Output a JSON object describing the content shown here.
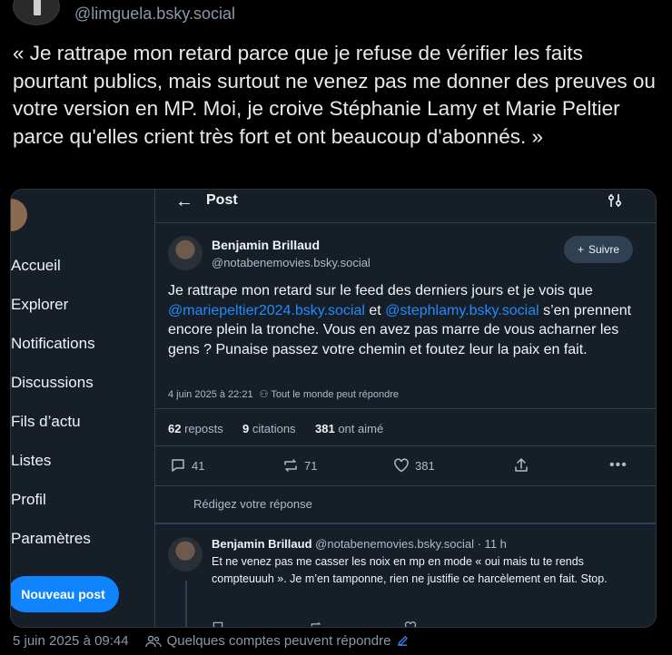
{
  "outer_post": {
    "handle": "@limguela.bsky.social",
    "text": "« Je rattrape mon retard parce que je refuse de vérifier les faits pourtant publics, mais surtout ne venez pas me donner des preuves ou votre version en MP. Moi, je croive Stéphanie Lamy et Marie Peltier parce qu'elles crient très fort et ont beaucoup d'abonnés. »",
    "timestamp": "5 juin 2025 à 09:44",
    "reply_setting": "Quelques comptes peuvent répondre"
  },
  "sidebar": {
    "items": [
      {
        "label": "Accueil"
      },
      {
        "label": "Explorer"
      },
      {
        "label": "Notifications"
      },
      {
        "label": "Discussions"
      },
      {
        "label": "Fils d’actu"
      },
      {
        "label": "Listes"
      },
      {
        "label": "Profil"
      },
      {
        "label": "Paramètres"
      }
    ],
    "new_post_label": "Nouveau post"
  },
  "topbar": {
    "title": "Post"
  },
  "post": {
    "author_name": "Benjamin Brillaud",
    "author_handle": "@notabenemovies.bsky.social",
    "follow_label": "Suivre",
    "text_part1": "Je rattrape mon retard sur le feed des derniers jours et je vois que ",
    "mention1": "@mariepeltier2024.bsky.social",
    "text_part2": " et ",
    "mention2": "@stephlamy.bsky.social",
    "text_part3": " s’en prennent encore plein la tronche. Vous en avez pas marre de vous acharner les gens ? Punaise passez votre chemin et foutez leur la paix en fait.",
    "date": "4 juin 2025 à 22:21",
    "reply_setting": "Tout le monde peut répondre",
    "reposts_count": "62",
    "reposts_label": "reposts",
    "quotes_count": "9",
    "quotes_label": "citations",
    "likes_count": "381",
    "likes_label": "ont aimé",
    "reply_action_count": "41",
    "repost_action_count": "71",
    "like_action_count": "381"
  },
  "reply_box": {
    "placeholder": "Rédigez votre réponse"
  },
  "reply": {
    "author_name": "Benjamin Brillaud",
    "author_handle": "@notabenemovies.bsky.social",
    "age": "· 11 h",
    "text": "Et ne venez pas me casser les noix en mp en mode « oui mais tu te rends compteuuuh ». Je m’en tamponne, rien ne justifie ce harcèlement en fait. Stop."
  }
}
